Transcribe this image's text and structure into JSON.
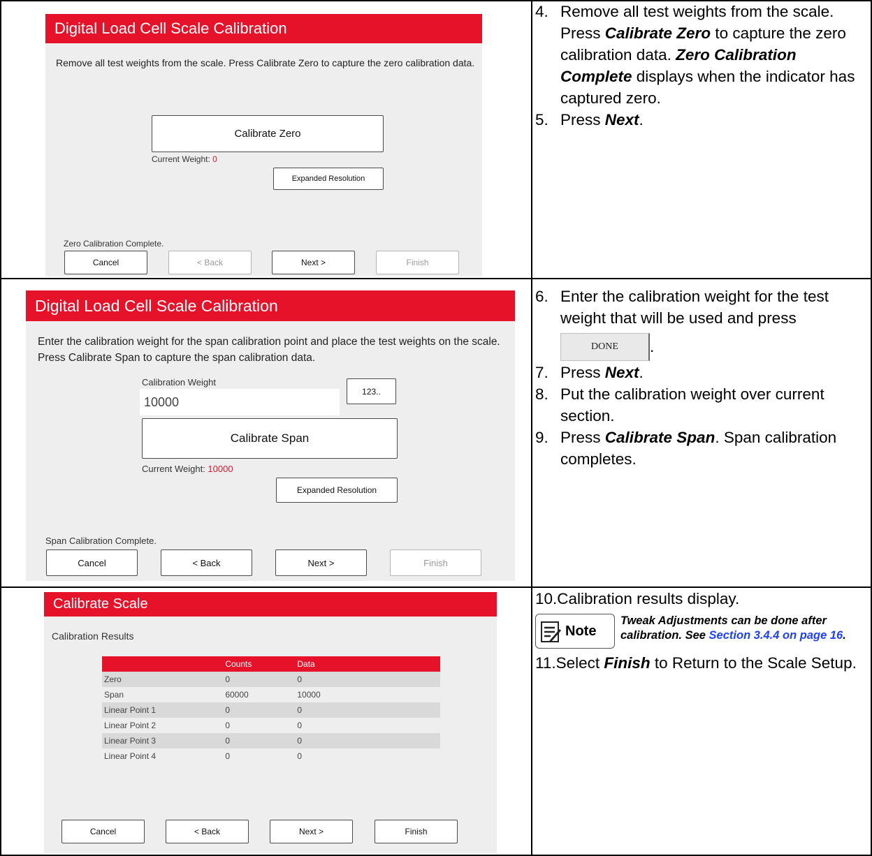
{
  "row1": {
    "header": "Digital Load Cell Scale Calibration",
    "instruction": "Remove all test weights from the scale. Press Calibrate Zero to capture the zero calibration data.",
    "calibrate_button": "Calibrate Zero",
    "current_weight_label": "Current Weight:",
    "current_weight_value": "0",
    "expanded_resolution": "Expanded Resolution",
    "status": "Zero Calibration Complete.",
    "cancel": "Cancel",
    "back": "< Back",
    "next": "Next >",
    "finish": "Finish"
  },
  "row2": {
    "header": "Digital Load Cell Scale Calibration",
    "instruction": "Enter the calibration weight for the span calibration point and place the test weights on the scale. Press Calibrate Span to capture the span calibration data.",
    "weight_label": "Calibration Weight",
    "weight_value": "10000",
    "keypad_button": "123..",
    "calibrate_button": "Calibrate Span",
    "current_weight_label": "Current Weight:",
    "current_weight_value": "10000",
    "expanded_resolution": "Expanded Resolution",
    "status": "Span Calibration Complete.",
    "cancel": "Cancel",
    "back": "< Back",
    "next": "Next >",
    "finish": "Finish"
  },
  "row3": {
    "header": "Calibrate Scale",
    "subtitle": "Calibration Results",
    "columns": [
      "",
      "Counts",
      "Data"
    ],
    "rows": [
      [
        "Zero",
        "0",
        "0"
      ],
      [
        "Span",
        "60000",
        "10000"
      ],
      [
        "Linear Point 1",
        "0",
        "0"
      ],
      [
        "Linear Point 2",
        "0",
        "0"
      ],
      [
        "Linear Point 3",
        "0",
        "0"
      ],
      [
        "Linear Point 4",
        "0",
        "0"
      ]
    ],
    "cancel": "Cancel",
    "back": "< Back",
    "next": "Next >",
    "finish": "Finish"
  },
  "steps": {
    "s4_num": "4.",
    "s4_a": "Remove all test weights from the scale. Press ",
    "s4_b": "Calibrate Zero",
    "s4_c": " to capture the zero calibration data. ",
    "s4_d": "Zero Calibration Complete",
    "s4_e": " displays when the indicator has captured zero.",
    "s5_num": "5.",
    "s5_a": "Press ",
    "s5_b": "Next",
    "s5_c": ".",
    "s6_num": "6.",
    "s6_a": "Enter the calibration weight for the test weight that will be used and press",
    "s6_done": "DONE",
    "s6_c": ".",
    "s7_num": "7.",
    "s7_a": "Press ",
    "s7_b": "Next",
    "s7_c": ".",
    "s8_num": "8.",
    "s8_a": "Put the calibration weight over current section.",
    "s9_num": "9.",
    "s9_a": "Press ",
    "s9_b": "Calibrate Span",
    "s9_c": ". Span calibration completes.",
    "s10_num": "10.",
    "s10_a": "Calibration results display.",
    "note_label": "Note",
    "note_a": "Tweak Adjustments can be done after calibration. See ",
    "note_link": "Section 3.4.4 on page 16",
    "note_c": ".",
    "s11_num": "11.",
    "s11_a": "Select ",
    "s11_b": "Finish",
    "s11_c": " to Return to the Scale Setup."
  }
}
